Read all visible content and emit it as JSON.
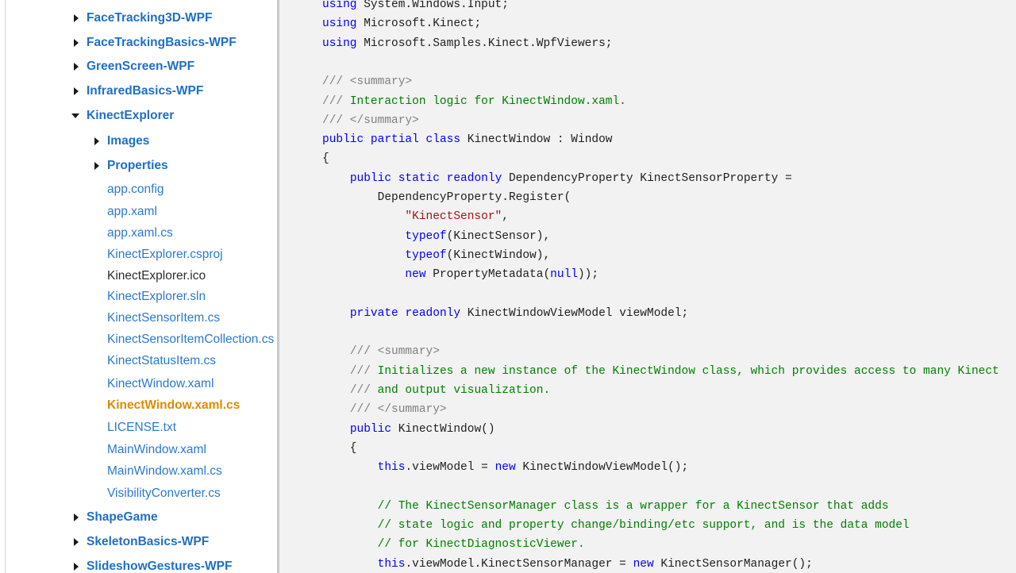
{
  "tree": {
    "items": [
      {
        "label": "FaceTracking3D-WPF",
        "kind": "folder",
        "state": "collapsed",
        "level": 0
      },
      {
        "label": "FaceTrackingBasics-WPF",
        "kind": "folder",
        "state": "collapsed",
        "level": 0
      },
      {
        "label": "GreenScreen-WPF",
        "kind": "folder",
        "state": "collapsed",
        "level": 0
      },
      {
        "label": "InfraredBasics-WPF",
        "kind": "folder",
        "state": "collapsed",
        "level": 0
      },
      {
        "label": "KinectExplorer",
        "kind": "folder",
        "state": "expanded",
        "level": 0
      },
      {
        "label": "Images",
        "kind": "folder",
        "state": "collapsed",
        "level": 1
      },
      {
        "label": "Properties",
        "kind": "folder",
        "state": "collapsed",
        "level": 1
      },
      {
        "label": "app.config",
        "kind": "file",
        "level": 1
      },
      {
        "label": "app.xaml",
        "kind": "file",
        "level": 1
      },
      {
        "label": "app.xaml.cs",
        "kind": "file",
        "level": 1
      },
      {
        "label": "KinectExplorer.csproj",
        "kind": "file",
        "level": 1
      },
      {
        "label": "KinectExplorer.ico",
        "kind": "file",
        "style": "plain",
        "level": 1
      },
      {
        "label": "KinectExplorer.sln",
        "kind": "file",
        "level": 1
      },
      {
        "label": "KinectSensorItem.cs",
        "kind": "file",
        "level": 1
      },
      {
        "label": "KinectSensorItemCollection.cs",
        "kind": "file",
        "level": 1
      },
      {
        "label": "KinectStatusItem.cs",
        "kind": "file",
        "level": 1
      },
      {
        "label": "KinectWindow.xaml",
        "kind": "file",
        "level": 1
      },
      {
        "label": "KinectWindow.xaml.cs",
        "kind": "file",
        "style": "selected",
        "level": 1
      },
      {
        "label": "LICENSE.txt",
        "kind": "file",
        "level": 1
      },
      {
        "label": "MainWindow.xaml",
        "kind": "file",
        "level": 1
      },
      {
        "label": "MainWindow.xaml.cs",
        "kind": "file",
        "level": 1
      },
      {
        "label": "VisibilityConverter.cs",
        "kind": "file",
        "level": 1
      },
      {
        "label": "ShapeGame",
        "kind": "folder",
        "state": "collapsed",
        "level": 0
      },
      {
        "label": "SkeletonBasics-WPF",
        "kind": "folder",
        "state": "collapsed",
        "level": 0
      },
      {
        "label": "SlideshowGestures-WPF",
        "kind": "folder",
        "state": "collapsed",
        "level": 0
      }
    ]
  },
  "code": {
    "lines": [
      [
        {
          "t": "using",
          "c": "kw"
        },
        {
          "t": " System.Windows.Input;",
          "c": ""
        }
      ],
      [
        {
          "t": "using",
          "c": "kw"
        },
        {
          "t": " Microsoft.Kinect;",
          "c": ""
        }
      ],
      [
        {
          "t": "using",
          "c": "kw"
        },
        {
          "t": " Microsoft.Samples.Kinect.WpfViewers;",
          "c": ""
        }
      ],
      [],
      [
        {
          "t": "/// <summary>",
          "c": "doc"
        }
      ],
      [
        {
          "t": "/// ",
          "c": "doc"
        },
        {
          "t": "Interaction logic for KinectWindow.xaml.",
          "c": "cm"
        }
      ],
      [
        {
          "t": "/// </summary>",
          "c": "doc"
        }
      ],
      [
        {
          "t": "public",
          "c": "kw"
        },
        {
          "t": " ",
          "c": ""
        },
        {
          "t": "partial",
          "c": "kw"
        },
        {
          "t": " ",
          "c": ""
        },
        {
          "t": "class",
          "c": "kw"
        },
        {
          "t": " KinectWindow : Window",
          "c": ""
        }
      ],
      [
        {
          "t": "{",
          "c": ""
        }
      ],
      [
        {
          "t": "    ",
          "c": ""
        },
        {
          "t": "public",
          "c": "kw"
        },
        {
          "t": " ",
          "c": ""
        },
        {
          "t": "static",
          "c": "kw"
        },
        {
          "t": " ",
          "c": ""
        },
        {
          "t": "readonly",
          "c": "kw"
        },
        {
          "t": " DependencyProperty KinectSensorProperty =",
          "c": ""
        }
      ],
      [
        {
          "t": "        DependencyProperty.Register(",
          "c": ""
        }
      ],
      [
        {
          "t": "            ",
          "c": ""
        },
        {
          "t": "\"KinectSensor\"",
          "c": "str"
        },
        {
          "t": ",",
          "c": ""
        }
      ],
      [
        {
          "t": "            ",
          "c": ""
        },
        {
          "t": "typeof",
          "c": "kw"
        },
        {
          "t": "(KinectSensor),",
          "c": ""
        }
      ],
      [
        {
          "t": "            ",
          "c": ""
        },
        {
          "t": "typeof",
          "c": "kw"
        },
        {
          "t": "(KinectWindow),",
          "c": ""
        }
      ],
      [
        {
          "t": "            ",
          "c": ""
        },
        {
          "t": "new",
          "c": "kw"
        },
        {
          "t": " PropertyMetadata(",
          "c": ""
        },
        {
          "t": "null",
          "c": "kw"
        },
        {
          "t": "));",
          "c": ""
        }
      ],
      [],
      [
        {
          "t": "    ",
          "c": ""
        },
        {
          "t": "private",
          "c": "kw"
        },
        {
          "t": " ",
          "c": ""
        },
        {
          "t": "readonly",
          "c": "kw"
        },
        {
          "t": " KinectWindowViewModel viewModel;",
          "c": ""
        }
      ],
      [],
      [
        {
          "t": "    ",
          "c": ""
        },
        {
          "t": "/// <summary>",
          "c": "doc"
        }
      ],
      [
        {
          "t": "    ",
          "c": ""
        },
        {
          "t": "/// ",
          "c": "doc"
        },
        {
          "t": "Initializes a new instance of the KinectWindow class, which provides access to many Kinect",
          "c": "cm"
        }
      ],
      [
        {
          "t": "    ",
          "c": ""
        },
        {
          "t": "/// ",
          "c": "doc"
        },
        {
          "t": "and output visualization.",
          "c": "cm"
        }
      ],
      [
        {
          "t": "    ",
          "c": ""
        },
        {
          "t": "/// </summary>",
          "c": "doc"
        }
      ],
      [
        {
          "t": "    ",
          "c": ""
        },
        {
          "t": "public",
          "c": "kw"
        },
        {
          "t": " KinectWindow()",
          "c": ""
        }
      ],
      [
        {
          "t": "    {",
          "c": ""
        }
      ],
      [
        {
          "t": "        ",
          "c": ""
        },
        {
          "t": "this",
          "c": "kw"
        },
        {
          "t": ".viewModel = ",
          "c": ""
        },
        {
          "t": "new",
          "c": "kw"
        },
        {
          "t": " KinectWindowViewModel();",
          "c": ""
        }
      ],
      [],
      [
        {
          "t": "        ",
          "c": ""
        },
        {
          "t": "// The KinectSensorManager class is a wrapper for a KinectSensor that adds",
          "c": "cm"
        }
      ],
      [
        {
          "t": "        ",
          "c": ""
        },
        {
          "t": "// state logic and property change/binding/etc support, and is the data model",
          "c": "cm"
        }
      ],
      [
        {
          "t": "        ",
          "c": ""
        },
        {
          "t": "// for KinectDiagnosticViewer.",
          "c": "cm"
        }
      ],
      [
        {
          "t": "        ",
          "c": ""
        },
        {
          "t": "this",
          "c": "kw"
        },
        {
          "t": ".viewModel.KinectSensorManager = ",
          "c": ""
        },
        {
          "t": "new",
          "c": "kw"
        },
        {
          "t": " KinectSensorManager();",
          "c": ""
        }
      ]
    ]
  }
}
